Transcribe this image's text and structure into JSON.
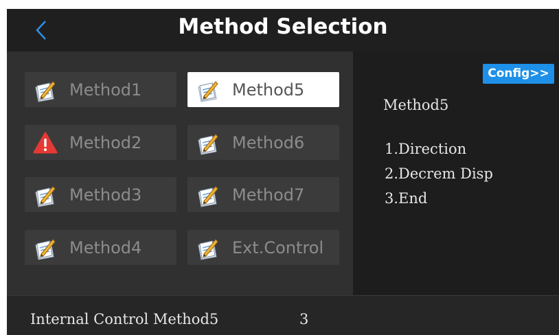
{
  "header": {
    "title": "Method Selection",
    "back_icon": "chevron-left-icon",
    "back_color": "#2f8fe8"
  },
  "methods": [
    {
      "label": "Method1",
      "icon": "edit-note-icon",
      "selected": false
    },
    {
      "label": "Method5",
      "icon": "edit-note-icon",
      "selected": true
    },
    {
      "label": "Method2",
      "icon": "warning-icon",
      "selected": false
    },
    {
      "label": "Method6",
      "icon": "edit-note-icon",
      "selected": false
    },
    {
      "label": "Method3",
      "icon": "edit-note-icon",
      "selected": false
    },
    {
      "label": "Method7",
      "icon": "edit-note-icon",
      "selected": false
    },
    {
      "label": "Method4",
      "icon": "edit-note-icon",
      "selected": false
    },
    {
      "label": "Ext.Control",
      "icon": "edit-note-icon",
      "selected": false
    }
  ],
  "detail": {
    "config_label": "Config>>",
    "method_name": "Method5",
    "steps": [
      "1.Direction",
      "2.Decrem Disp",
      "3.End"
    ]
  },
  "status": {
    "text": "Internal Control Method5",
    "count": "3"
  },
  "colors": {
    "accent": "#1e90e8",
    "warning": "#e53935",
    "selected_bg": "#ffffff"
  }
}
